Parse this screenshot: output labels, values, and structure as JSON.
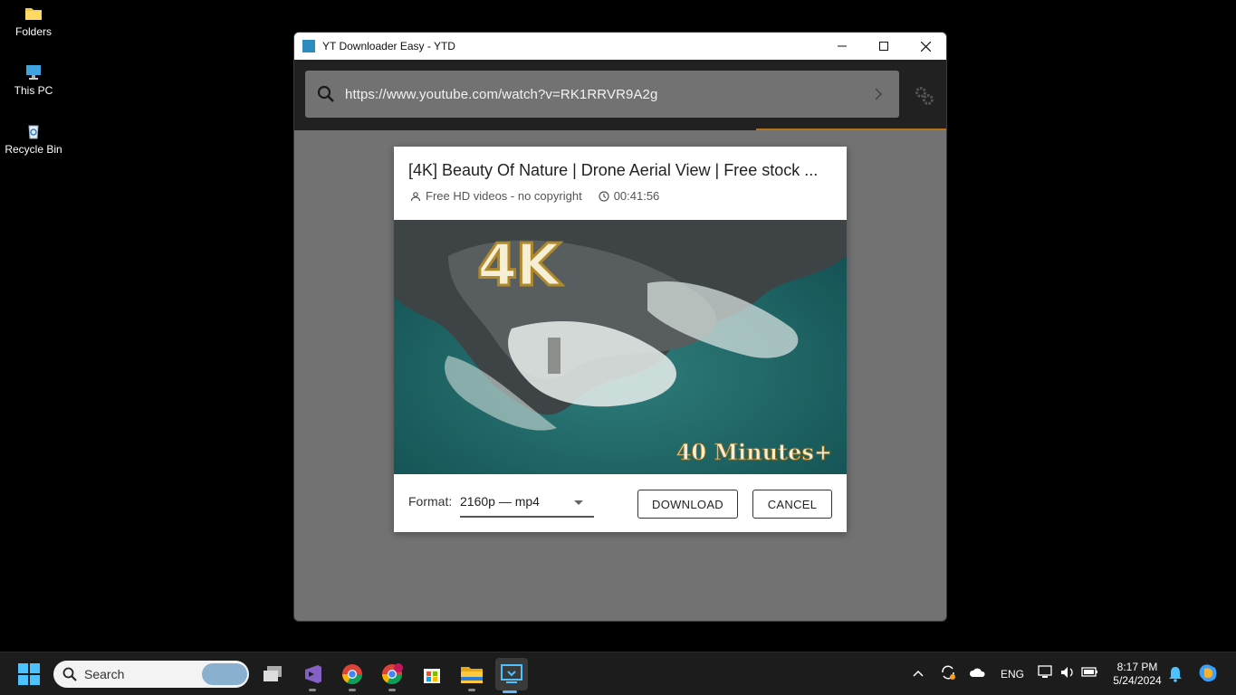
{
  "desktop": {
    "icons": [
      {
        "label": "Folders"
      },
      {
        "label": "This PC"
      },
      {
        "label": "Recycle Bin"
      }
    ]
  },
  "window": {
    "title": "YT Downloader Easy - YTD",
    "url": "https://www.youtube.com/watch?v=RK1RRVR9A2g"
  },
  "dialog": {
    "video_title": "[4K] Beauty Of Nature | Drone Aerial View | Free stock ...",
    "channel": "Free HD videos - no copyright",
    "duration": "00:41:56",
    "thumb_badge": "4K",
    "thumb_caption": "40 Minutes+",
    "format_label": "Format:",
    "format_value": "2160p — mp4",
    "download_label": "DOWNLOAD",
    "cancel_label": "CANCEL"
  },
  "taskbar": {
    "search_placeholder": "Search",
    "tray": {
      "language": "ENG",
      "time": "8:17 PM",
      "date": "5/24/2024"
    }
  },
  "colors": {
    "window_bg": "#727272",
    "toolbar_bg": "#212121",
    "accent_progress": "#b5741c"
  }
}
